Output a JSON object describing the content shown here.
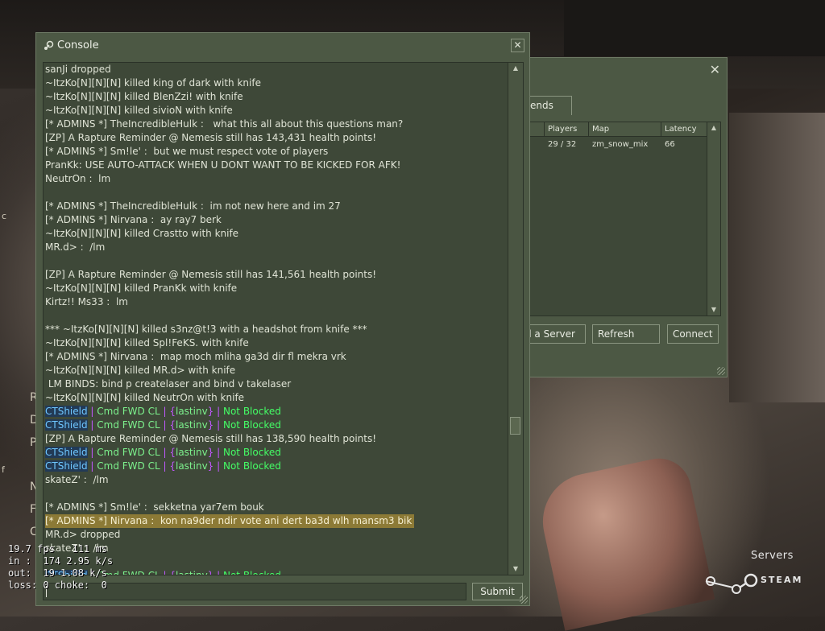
{
  "background": {
    "letters": [
      "R",
      "D",
      "P",
      "N",
      "F",
      "C",
      "c",
      "f"
    ]
  },
  "server_browser": {
    "tab_label": "ends",
    "columns": [
      "Players",
      "Map",
      "Latency"
    ],
    "row": {
      "players": "29 / 32",
      "map": "zm_snow_mix",
      "latency": "66"
    },
    "buttons": {
      "add_server": "d a Server",
      "refresh": "Refresh",
      "connect": "Connect"
    },
    "close_glyph": "✕"
  },
  "console": {
    "title": "Console",
    "close_glyph": "✕",
    "submit_label": "Submit",
    "lines": [
      {
        "kind": "text",
        "text": "sanJi dropped"
      },
      {
        "kind": "text",
        "text": "~ItzKo[N][N][N] killed king of dark with knife"
      },
      {
        "kind": "text",
        "text": "~ItzKo[N][N][N] killed BlenZzi! with knife"
      },
      {
        "kind": "text",
        "text": "~ItzKo[N][N][N] killed sivioN with knife"
      },
      {
        "kind": "text",
        "text": "[* ADMINS *] TheIncredibleHulk :   what this all about this questions man?"
      },
      {
        "kind": "text",
        "text": "[ZP] A Rapture Reminder @ Nemesis still has 143,431 health points!"
      },
      {
        "kind": "text",
        "text": "[* ADMINS *] Sm!le' :  but we must respect vote of players"
      },
      {
        "kind": "text",
        "text": "PranKk: USE AUTO-ATTACK WHEN U DONT WANT TO BE KICKED FOR AFK!"
      },
      {
        "kind": "text",
        "text": "NeutrOn :  lm"
      },
      {
        "kind": "text",
        "text": ""
      },
      {
        "kind": "text",
        "text": "[* ADMINS *] TheIncredibleHulk :  im not new here and im 27"
      },
      {
        "kind": "text",
        "text": "[* ADMINS *] Nirvana :  ay ray7 berk"
      },
      {
        "kind": "text",
        "text": "~ItzKo[N][N][N] killed Crastto with knife"
      },
      {
        "kind": "text",
        "text": "MR.d> :  /lm"
      },
      {
        "kind": "text",
        "text": ""
      },
      {
        "kind": "text",
        "text": "[ZP] A Rapture Reminder @ Nemesis still has 141,561 health points!"
      },
      {
        "kind": "text",
        "text": "~ItzKo[N][N][N] killed PranKk with knife"
      },
      {
        "kind": "text",
        "text": "Kirtz!! Ms33 :  lm"
      },
      {
        "kind": "text",
        "text": ""
      },
      {
        "kind": "text",
        "text": "*** ~ItzKo[N][N][N] killed s3nz@t!3 with a headshot from knife ***"
      },
      {
        "kind": "text",
        "text": "~ItzKo[N][N][N] killed Spl!FeKS. with knife"
      },
      {
        "kind": "text",
        "text": "[* ADMINS *] Nirvana :  map moch mliha ga3d dir fl mekra vrk"
      },
      {
        "kind": "text",
        "text": "~ItzKo[N][N][N] killed MR.d> with knife"
      },
      {
        "kind": "text",
        "text": " LM BINDS: bind p createlaser and bind v takelaser"
      },
      {
        "kind": "text",
        "text": "~ItzKo[N][N][N] killed NeutrOn with knife"
      },
      {
        "kind": "shield"
      },
      {
        "kind": "shield"
      },
      {
        "kind": "text",
        "text": "[ZP] A Rapture Reminder @ Nemesis still has 138,590 health points!"
      },
      {
        "kind": "shield"
      },
      {
        "kind": "shield"
      },
      {
        "kind": "text",
        "text": "skateZ' :  /lm"
      },
      {
        "kind": "text",
        "text": ""
      },
      {
        "kind": "text",
        "text": "[* ADMINS *] Sm!le' :  sekketna yar7em bouk"
      },
      {
        "kind": "highlight",
        "text": "[* ADMINS *] Nirvana :  kon na9der ndir vote ani dert ba3d wlh mansm3 bik"
      },
      {
        "kind": "text",
        "text": "MR.d> dropped"
      },
      {
        "kind": "text",
        "text": "skateZ' :  /lm"
      },
      {
        "kind": "text",
        "text": ""
      },
      {
        "kind": "shield"
      }
    ],
    "shield_parts": {
      "name": "CTShield",
      "cmd": "Cmd FWD CL",
      "open": "{",
      "value": "lastinv",
      "close": "}",
      "status": "Not Blocked"
    }
  },
  "netgraph": {
    "fps": "19.7 fps   111 ms",
    "in": "in :  174 2.95 k/s",
    "out": "out:  19 1.08 k/s",
    "loss": "loss: 0 choke:  0"
  },
  "steam": {
    "servers_label": "Servers",
    "wordmark": "STEAM"
  },
  "colors": {
    "panel": "#4c5844",
    "panel_dark": "#3e4838",
    "highlight": "#8c7a36",
    "shield_name": "#6ec6ff",
    "shield_cmd": "#7cf08c",
    "shield_brace": "#c058ff",
    "not_blocked": "#44ff66"
  }
}
